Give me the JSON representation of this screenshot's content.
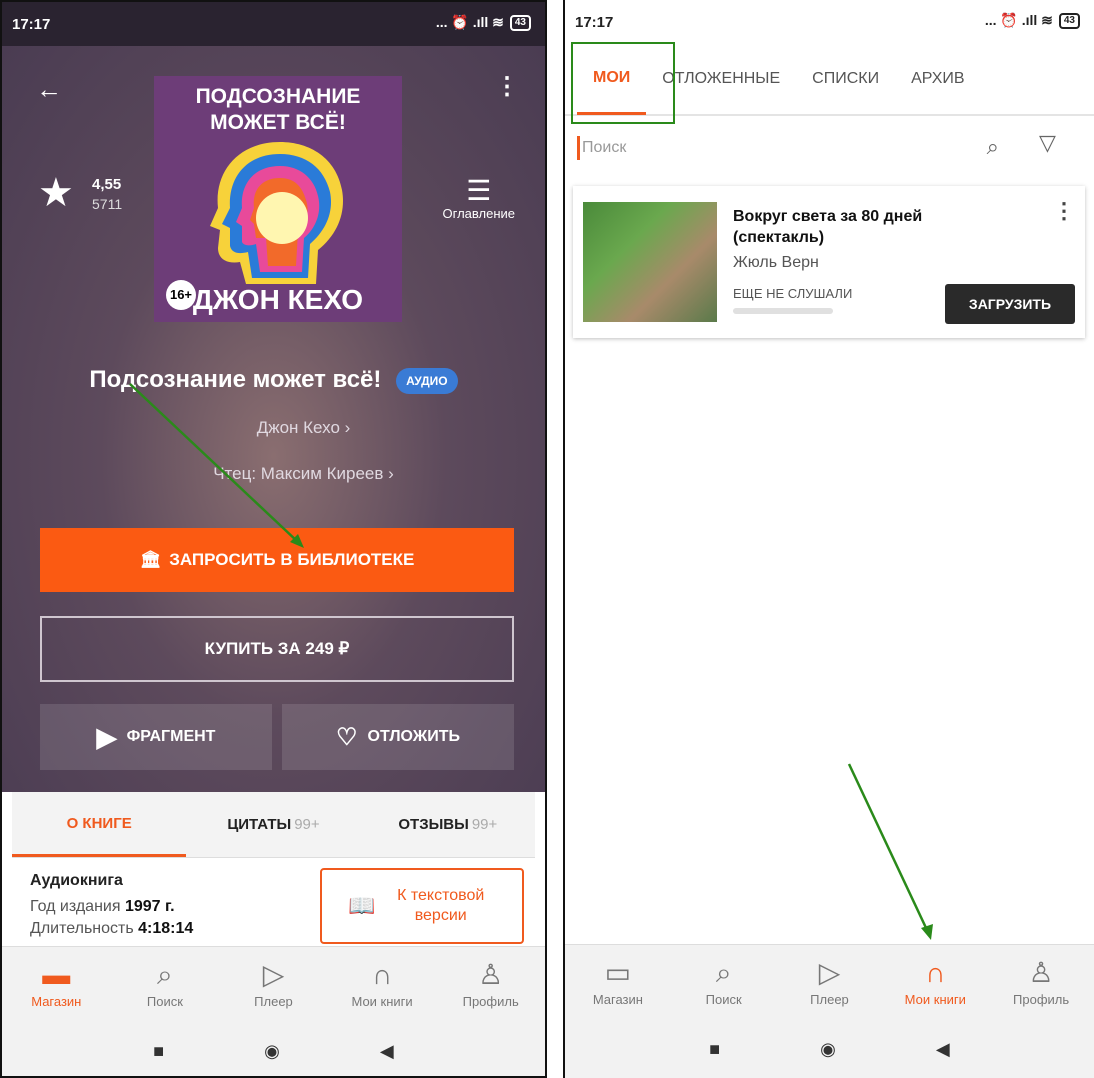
{
  "left": {
    "status": {
      "time": "17:17",
      "icons": "... ⏰ .ıll ≋",
      "battery": "43"
    },
    "cover": {
      "title_line1": "ПОДСОЗНАНИЕ",
      "title_line2": "МОЖЕТ ВСЁ!",
      "author": "ДЖОН КЕХО",
      "age": "16+"
    },
    "rating": {
      "value": "4,55",
      "count": "5711"
    },
    "toc_label": "Оглавление",
    "book_title": "Подсознание может всё!",
    "badge": "АУДИО",
    "author": "Джон Кехо  ›",
    "reader": "Чтец: Максим Киреев  ›",
    "request_button": "ЗАПРОСИТЬ В БИБЛИОТЕКЕ",
    "buy_button": "КУПИТЬ ЗА 249 ₽",
    "fragment_button": "ФРАГМЕНТ",
    "later_button": "ОТЛОЖИТЬ",
    "tabs": [
      {
        "label": "О КНИГЕ",
        "count": ""
      },
      {
        "label": "ЦИТАТЫ",
        "count": "99+"
      },
      {
        "label": "ОТЗЫВЫ",
        "count": "99+"
      }
    ],
    "about": {
      "heading": "Аудиокнига",
      "year_label": "Год издания",
      "year_value": "1997 г.",
      "duration_label": "Длительность",
      "duration_value": "4:18:14"
    },
    "text_version_button": "К текстовой версии",
    "nav": [
      "Магазин",
      "Поиск",
      "Плеер",
      "Мои книги",
      "Профиль"
    ]
  },
  "right": {
    "status": {
      "time": "17:17",
      "icons": "... ⏰ .ıll ≋",
      "battery": "43"
    },
    "tabs": [
      "МОИ",
      "ОТЛОЖЕННЫЕ",
      "СПИСКИ",
      "АРХИВ"
    ],
    "search_placeholder": "Поиск",
    "book": {
      "title": "Вокруг света за 80 дней (спектакль)",
      "author": "Жюль Верн",
      "status": "ЕЩЕ НЕ СЛУШАЛИ",
      "progress": 0,
      "download_button": "ЗАГРУЗИТЬ"
    },
    "nav": [
      "Магазин",
      "Поиск",
      "Плеер",
      "Мои книги",
      "Профиль"
    ]
  },
  "colors": {
    "accent": "#f05a1e",
    "request": "#fb5a12",
    "annotation": "#2a8a1a",
    "hero": "#5d4a5c"
  }
}
